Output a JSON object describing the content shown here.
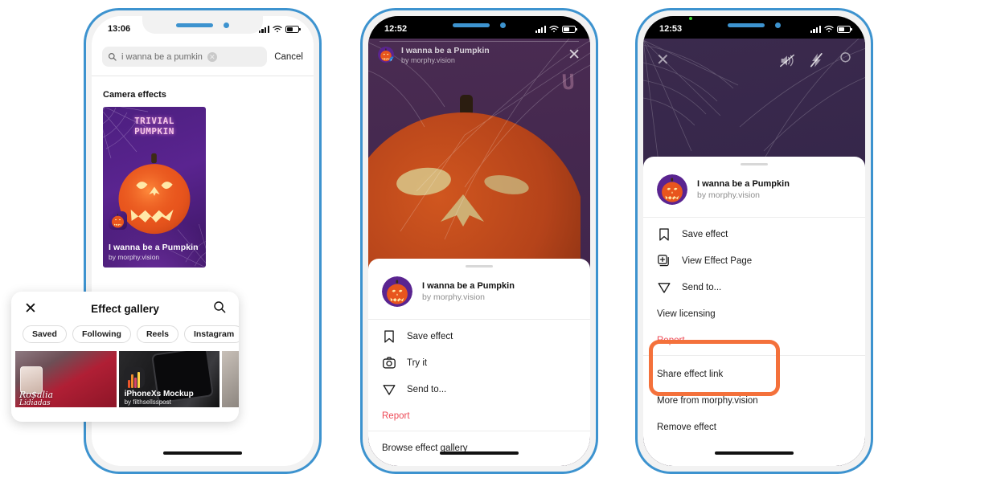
{
  "theme": {
    "frame_color": "#3d93cf",
    "accent_red": "#ed4956",
    "highlight_orange": "#f4713b"
  },
  "phone1": {
    "status": {
      "time": "13:06"
    },
    "search": {
      "value": "i wanna be a pumkin",
      "icon": "search-icon",
      "clear_icon": "clear-circle-icon",
      "cancel_label": "Cancel"
    },
    "section_title": "Camera effects",
    "card": {
      "overlay_text_line1": "TRIVIAL",
      "overlay_text_line2": "PUMPKIN",
      "title": "I wanna be a Pumpkin",
      "author": "by morphy.vision"
    },
    "gallery": {
      "close_icon": "close-icon",
      "title": "Effect gallery",
      "search_icon": "search-icon",
      "pills": [
        "Saved",
        "Following",
        "Reels",
        "Instagram"
      ],
      "thumbs": [
        {
          "title": "Ro$alia",
          "subtitle": "Lidiadas"
        },
        {
          "title": "iPhoneXs Mockup",
          "subtitle": "by filthsellsspost"
        }
      ]
    }
  },
  "phone2": {
    "status": {
      "time": "12:52"
    },
    "effect_header": {
      "title": "I wanna be a Pumpkin",
      "author": "by morphy.vision",
      "close_icon": "close-icon"
    },
    "scene_text": "U",
    "sheet": {
      "user": {
        "title": "I wanna be a Pumpkin",
        "author": "by morphy.vision"
      },
      "items": [
        {
          "label": "Save effect",
          "icon": "bookmark-icon"
        },
        {
          "label": "Try it",
          "icon": "camera-icon"
        },
        {
          "label": "Send to...",
          "icon": "send-icon"
        },
        {
          "label": "Report",
          "icon": "none",
          "danger": true
        }
      ],
      "footer_items": [
        {
          "label": "Browse effect gallery",
          "icon": "none"
        }
      ]
    }
  },
  "phone3": {
    "status": {
      "time": "12:53"
    },
    "camera_controls": {
      "close_icon": "close-icon",
      "mute_icon": "speaker-mute-icon",
      "flash_off_icon": "flash-off-icon",
      "settings_icon": "gear-icon"
    },
    "sheet": {
      "user": {
        "title": "I wanna be a Pumpkin",
        "author": "by morphy.vision"
      },
      "items": [
        {
          "label": "Save effect",
          "icon": "bookmark-icon"
        },
        {
          "label": "View Effect Page",
          "icon": "effect-page-icon"
        },
        {
          "label": "Send to...",
          "icon": "send-icon"
        },
        {
          "label": "View licensing",
          "icon": "none"
        },
        {
          "label": "Report",
          "icon": "none",
          "danger": true
        }
      ],
      "highlighted_items": [
        {
          "label": "Share effect link",
          "icon": "none"
        },
        {
          "label": "More from morphy.vision",
          "icon": "none"
        }
      ],
      "trailing_items": [
        {
          "label": "Remove effect",
          "icon": "none"
        }
      ]
    }
  }
}
